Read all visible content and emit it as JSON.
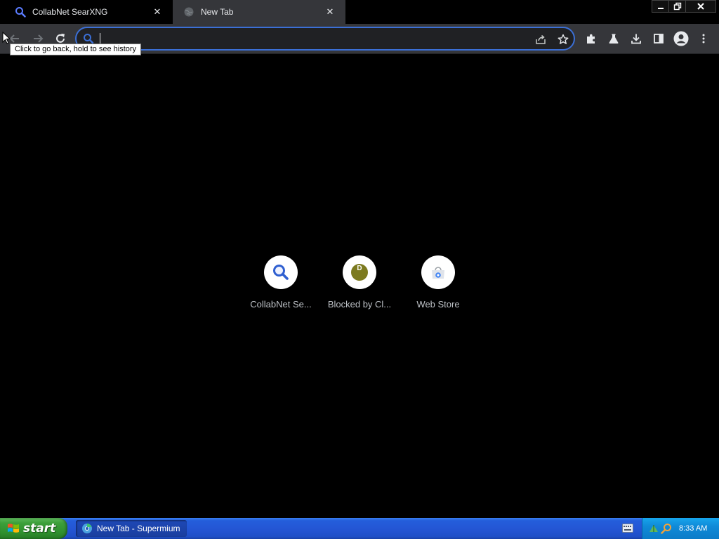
{
  "browser": {
    "tabs": [
      {
        "title": "CollabNet SearXNG",
        "favicon": "search-icon",
        "active": false
      },
      {
        "title": "New Tab",
        "favicon": "globe-icon",
        "active": true
      }
    ],
    "omnibox": {
      "value": "",
      "placeholder": ""
    },
    "tooltip": "Click to go back, hold to see history",
    "accent": "#3b6fd6"
  },
  "shortcuts": [
    {
      "label": "CollabNet Se...",
      "icon": "search-icon"
    },
    {
      "label": "Blocked by Cl...",
      "icon": "letter-d-icon",
      "letter": "D"
    },
    {
      "label": "Web Store",
      "icon": "web-store-icon"
    }
  ],
  "taskbar": {
    "start_label": "start",
    "items": [
      {
        "label": "New Tab - Supermium",
        "icon": "browser-icon"
      }
    ],
    "clock": "8:33 AM"
  }
}
